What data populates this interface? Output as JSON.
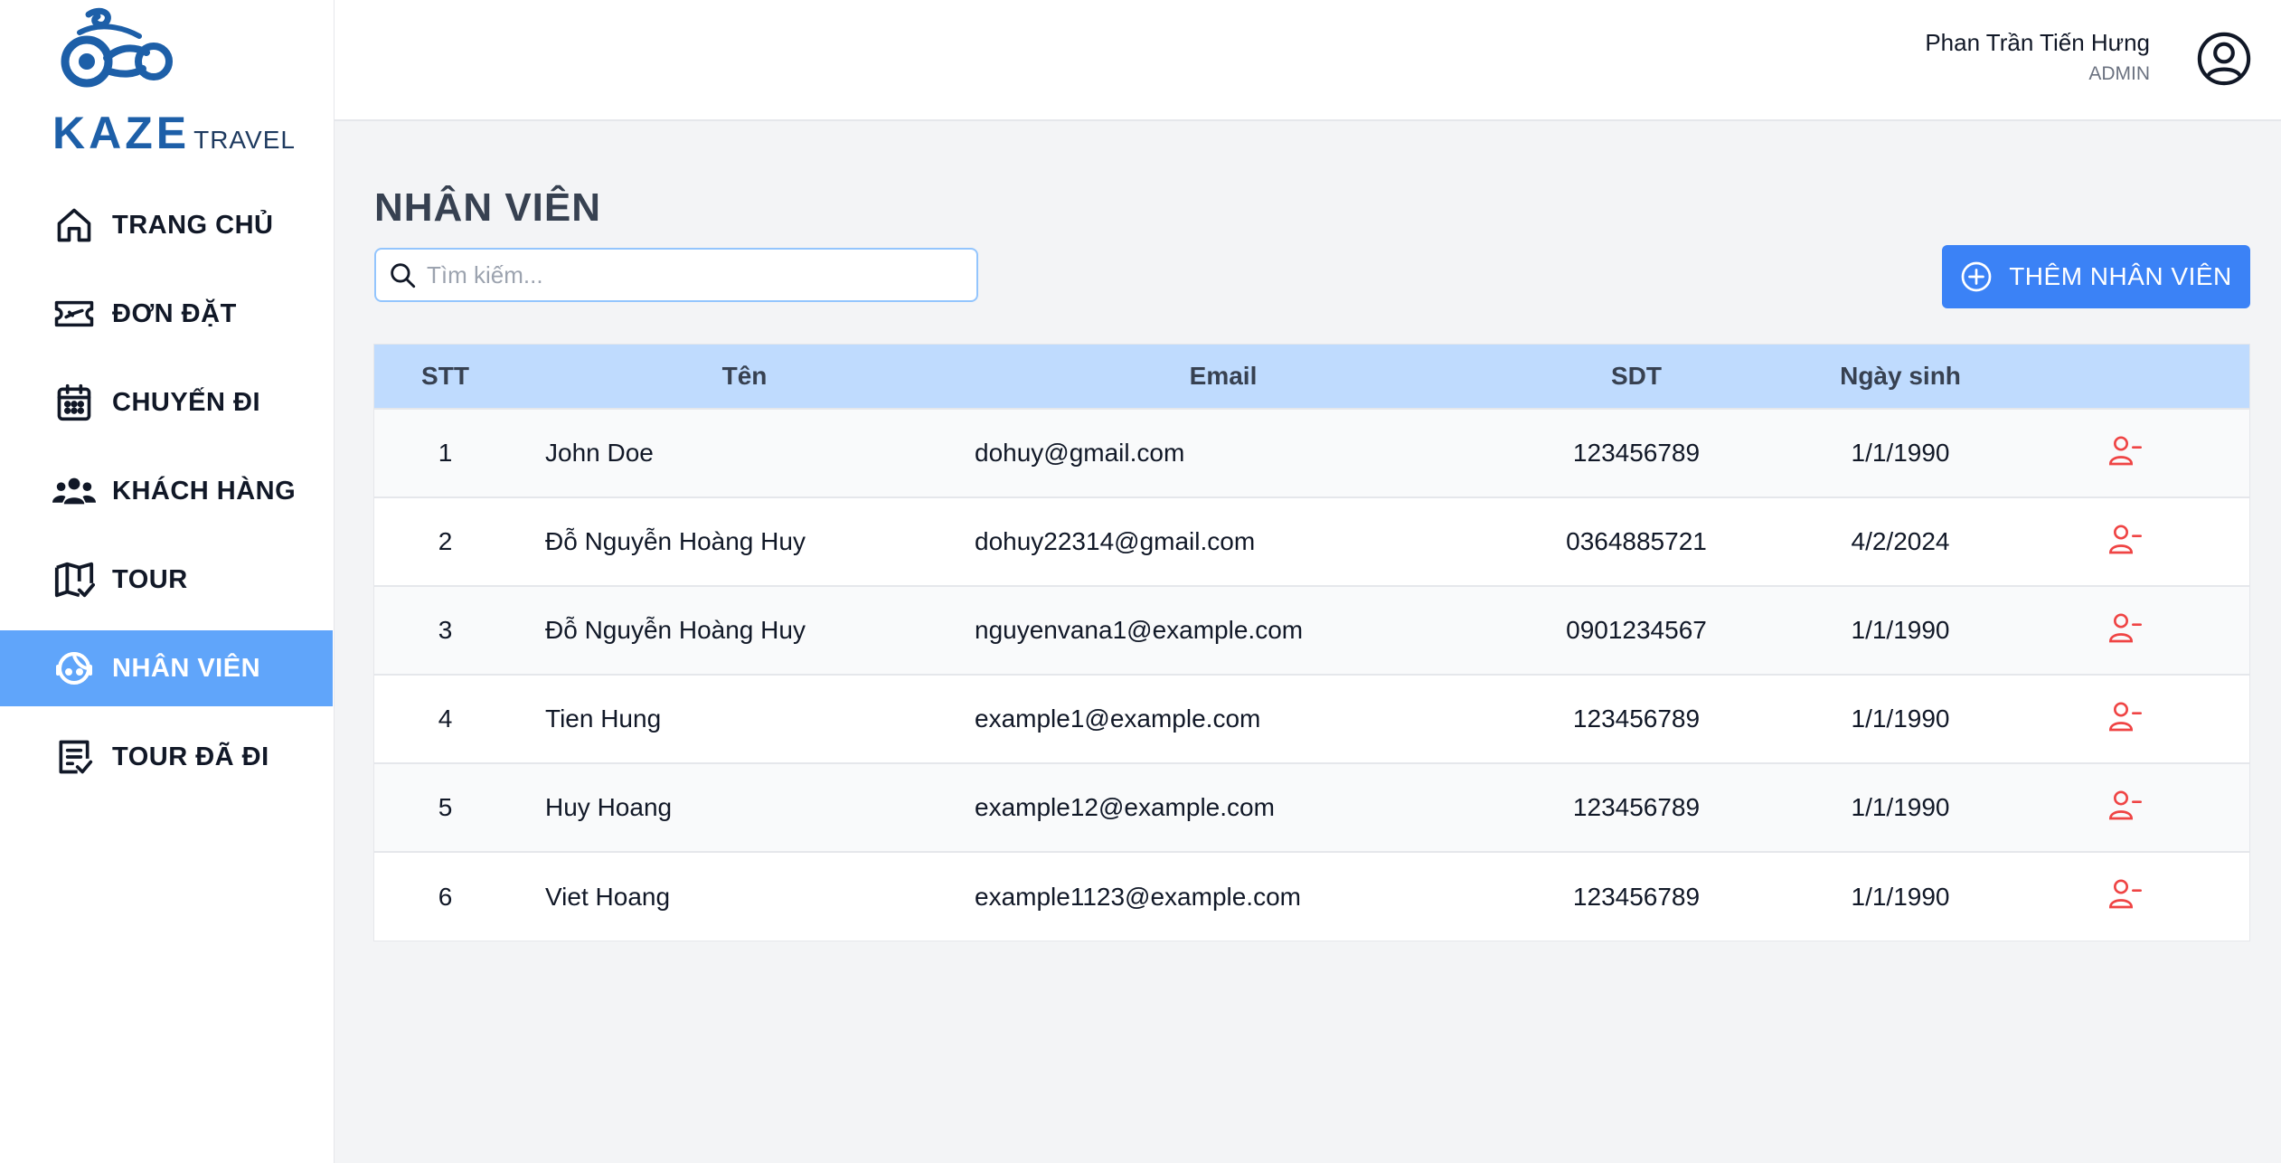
{
  "brand": {
    "name": "KAZE",
    "tagline": "TRAVEL",
    "color": "#1d5fa8"
  },
  "sidebar": {
    "items": [
      {
        "label": "TRANG CHỦ",
        "icon": "home-icon",
        "active": false
      },
      {
        "label": "ĐƠN ĐẶT",
        "icon": "ticket-icon",
        "active": false
      },
      {
        "label": "CHUYẾN ĐI",
        "icon": "calendar-icon",
        "active": false
      },
      {
        "label": "KHÁCH HÀNG",
        "icon": "users-icon",
        "active": false
      },
      {
        "label": "TOUR",
        "icon": "map-check-icon",
        "active": false
      },
      {
        "label": "NHÂN VIÊN",
        "icon": "staff-face-icon",
        "active": true
      },
      {
        "label": "TOUR ĐÃ ĐI",
        "icon": "checklist-icon",
        "active": false
      }
    ],
    "active_color": "#60a5fa"
  },
  "header": {
    "user_name": "Phan Trần Tiến Hưng",
    "user_role": "ADMIN",
    "avatar_icon": "user-circle-icon"
  },
  "main": {
    "title": "NHÂN VIÊN",
    "search": {
      "placeholder": "Tìm kiếm...",
      "value": "",
      "icon": "search-icon"
    },
    "add_button": {
      "label": "THÊM NHÂN VIÊN",
      "icon": "plus-circle-icon",
      "color": "#3b82f6"
    },
    "table": {
      "header_color": "#bfdbfe",
      "columns": [
        "STT",
        "Tên",
        "Email",
        "SDT",
        "Ngày sinh",
        ""
      ],
      "rows": [
        {
          "stt": "1",
          "name": "John Doe",
          "email": "dohuy@gmail.com",
          "sdt": "123456789",
          "dob": "1/1/1990"
        },
        {
          "stt": "2",
          "name": "Đỗ Nguyễn Hoàng Huy",
          "email": "dohuy22314@gmail.com",
          "sdt": "0364885721",
          "dob": "4/2/2024"
        },
        {
          "stt": "3",
          "name": "Đỗ Nguyễn Hoàng Huy",
          "email": "nguyenvana1@example.com",
          "sdt": "0901234567",
          "dob": "1/1/1990"
        },
        {
          "stt": "4",
          "name": "Tien Hung",
          "email": "example1@example.com",
          "sdt": "123456789",
          "dob": "1/1/1990"
        },
        {
          "stt": "5",
          "name": "Huy Hoang",
          "email": "example12@example.com",
          "sdt": "123456789",
          "dob": "1/1/1990"
        },
        {
          "stt": "6",
          "name": "Viet Hoang",
          "email": "example1123@example.com",
          "sdt": "123456789",
          "dob": "1/1/1990"
        }
      ],
      "row_action_icon": "remove-user-icon",
      "row_action_color": "#ef4444"
    }
  }
}
